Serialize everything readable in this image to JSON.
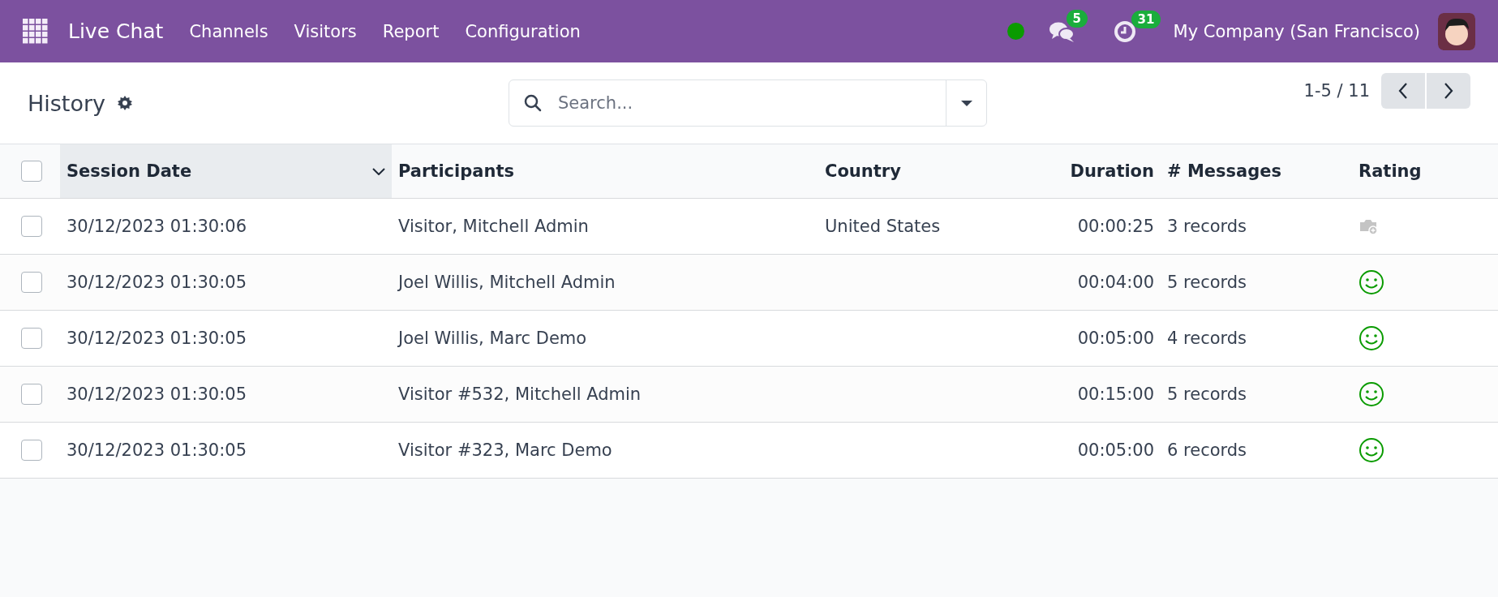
{
  "navbar": {
    "app_name": "Live Chat",
    "menu": [
      {
        "label": "Channels"
      },
      {
        "label": "Visitors"
      },
      {
        "label": "Report"
      },
      {
        "label": "Configuration"
      }
    ],
    "messages_badge": "5",
    "activities_badge": "31",
    "company": "My Company (San Francisco)"
  },
  "control_panel": {
    "title": "History",
    "search": {
      "placeholder": "Search..."
    },
    "pager": "1-5 / 11"
  },
  "table": {
    "select_all": {
      "checked": false
    },
    "columns": [
      {
        "label": "Session Date",
        "sorted": true
      },
      {
        "label": "Participants",
        "sorted": false
      },
      {
        "label": "Country",
        "sorted": false
      },
      {
        "label": "Duration",
        "sorted": false
      },
      {
        "label": "# Messages",
        "sorted": false
      },
      {
        "label": "Rating",
        "sorted": false
      }
    ],
    "rows": [
      {
        "checked": false,
        "session_date": "30/12/2023 01:30:06",
        "participants": "Visitor, Mitchell Admin",
        "country": "United States",
        "duration": "00:00:25",
        "messages": "3 records",
        "rating": {
          "kind": "none"
        }
      },
      {
        "checked": false,
        "session_date": "30/12/2023 01:30:05",
        "participants": "Joel Willis, Mitchell Admin",
        "duration": "00:04:00",
        "messages": "5 records",
        "rating": {
          "kind": "happy"
        }
      },
      {
        "checked": false,
        "session_date": "30/12/2023 01:30:05",
        "participants": "Joel Willis, Marc Demo",
        "duration": "00:05:00",
        "messages": "4 records",
        "rating": {
          "kind": "happy"
        }
      },
      {
        "checked": false,
        "session_date": "30/12/2023 01:30:05",
        "participants": "Visitor #532, Mitchell Admin",
        "duration": "00:15:00",
        "messages": "5 records",
        "rating": {
          "kind": "happy"
        }
      },
      {
        "checked": false,
        "session_date": "30/12/2023 01:30:05",
        "participants": "Visitor #323, Marc Demo",
        "duration": "00:05:00",
        "messages": "6 records",
        "rating": {
          "kind": "happy"
        }
      }
    ]
  }
}
